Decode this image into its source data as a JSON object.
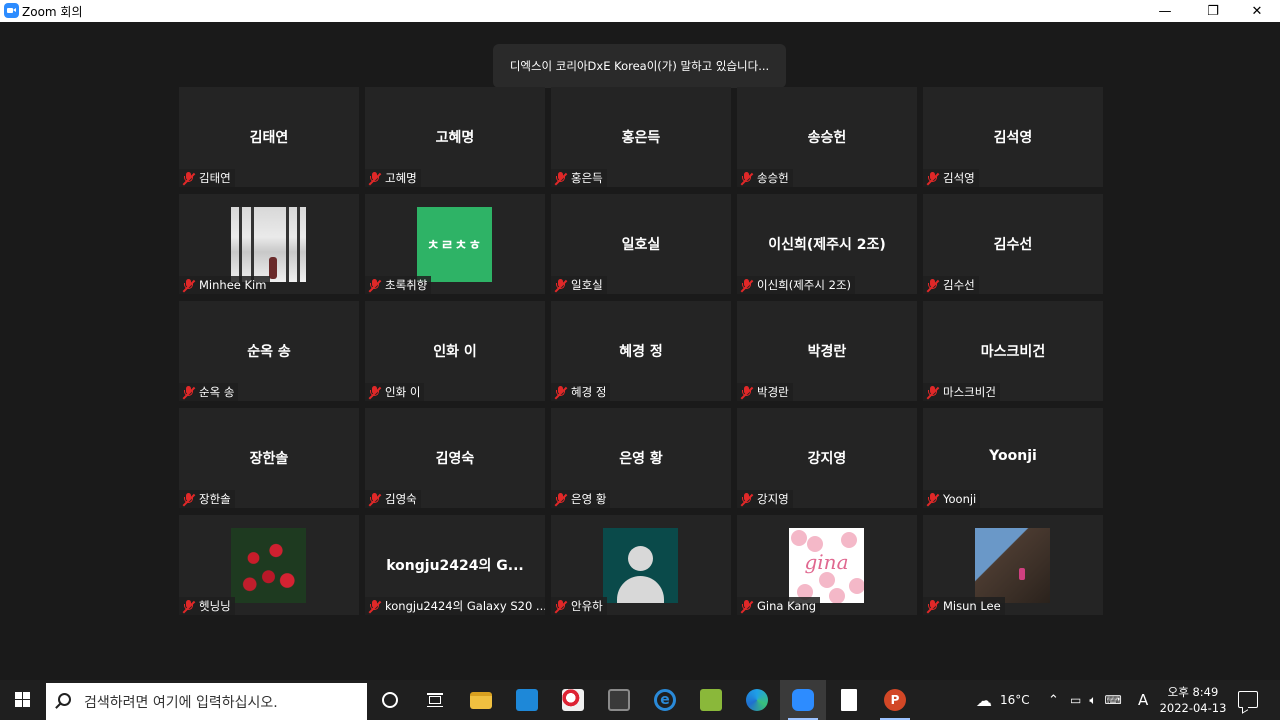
{
  "window": {
    "title": "Zoom 회의",
    "minimize": "—",
    "restore": "❐",
    "close": "✕"
  },
  "speaker_banner": "디엑스이 코리아DxE Korea이(가) 말하고 있습니다...",
  "participants": [
    {
      "display": "김태연",
      "name": "김태연"
    },
    {
      "display": "고혜명",
      "name": "고혜명"
    },
    {
      "display": "홍은득",
      "name": "홍은득"
    },
    {
      "display": "송승헌",
      "name": "송승헌"
    },
    {
      "display": "김석영",
      "name": "김석영"
    },
    {
      "display": "",
      "name": "Minhee Kim",
      "thumbnail": "snow-photo"
    },
    {
      "display": "",
      "name": "초록취향",
      "thumbnail": "green-logo",
      "thumb_text": "ㅊㄹㅊㅎ"
    },
    {
      "display": "일호실",
      "name": "일호실"
    },
    {
      "display": "이신희(제주시 2조)",
      "name": "이신희(제주시 2조)"
    },
    {
      "display": "김수선",
      "name": "김수선"
    },
    {
      "display": "순옥 송",
      "name": "순옥 송"
    },
    {
      "display": "인화 이",
      "name": "인화 이"
    },
    {
      "display": "혜경 정",
      "name": "혜경 정"
    },
    {
      "display": "박경란",
      "name": "박경란"
    },
    {
      "display": "마스크비건",
      "name": "마스크비건"
    },
    {
      "display": "장한솔",
      "name": "장한솔"
    },
    {
      "display": "김영숙",
      "name": "김영숙"
    },
    {
      "display": "은영 황",
      "name": "은영 황"
    },
    {
      "display": "강지영",
      "name": "강지영"
    },
    {
      "display": "Yoonji",
      "name": "Yoonji"
    },
    {
      "display": "",
      "name": "헷닝닝",
      "thumbnail": "red-flowers"
    },
    {
      "display": "kongju2424의 G...",
      "name": "kongju2424의 Galaxy S20 ..."
    },
    {
      "display": "",
      "name": "안유하",
      "thumbnail": "default-avatar"
    },
    {
      "display": "",
      "name": "Gina Kang",
      "thumbnail": "gina-pink",
      "thumb_text": "gina"
    },
    {
      "display": "",
      "name": "Misun Lee",
      "thumbnail": "rock-climb"
    }
  ],
  "taskbar": {
    "search_placeholder": "검색하려면 여기에 입력하십시오.",
    "weather": "16°C",
    "ime": "A",
    "time": "오후 8:49",
    "date": "2022-04-13"
  },
  "colors": {
    "zoom_blue": "#2d8cff",
    "muted_red": "#e02828",
    "tile_bg": "#242424"
  }
}
